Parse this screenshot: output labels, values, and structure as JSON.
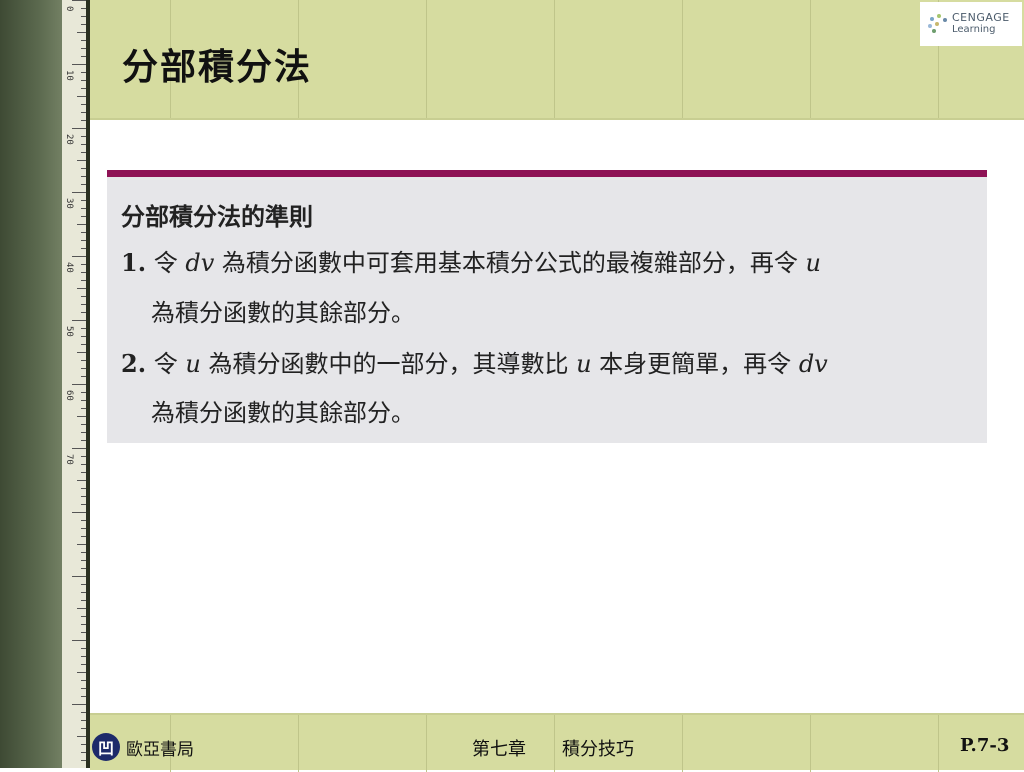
{
  "slide": {
    "title": "分部積分法"
  },
  "logo": {
    "line1": "CENGAGE",
    "line2": "Learning"
  },
  "rule_box": {
    "heading": "分部積分法的準則",
    "items": [
      {
        "number": "1.",
        "pre": "令 ",
        "var1": "dv",
        "mid": " 為積分函數中可套用基本積分公式的最複雜部分，再令 ",
        "var2": "u",
        "post": "",
        "cont": "為積分函數的其餘部分。"
      },
      {
        "number": "2.",
        "pre": "令 ",
        "var1": "u",
        "mid": " 為積分函數中的一部分，其導數比 ",
        "var2": "u",
        "post": " 本身更簡單，再令 ",
        "var3": "dv",
        "cont": "為積分函數的其餘部分。"
      }
    ]
  },
  "footer": {
    "publisher_mark": "凹",
    "publisher": "歐亞書局",
    "chapter": "第七章",
    "topic": "積分技巧",
    "page": "P.7-3"
  },
  "ruler": {
    "labels": [
      "0",
      "10",
      "20",
      "30",
      "40",
      "50",
      "60",
      "70"
    ]
  },
  "colors": {
    "header_band": "#d6dca0",
    "rule_accent": "#8e1255",
    "rule_box_bg": "#e6e6e9"
  }
}
